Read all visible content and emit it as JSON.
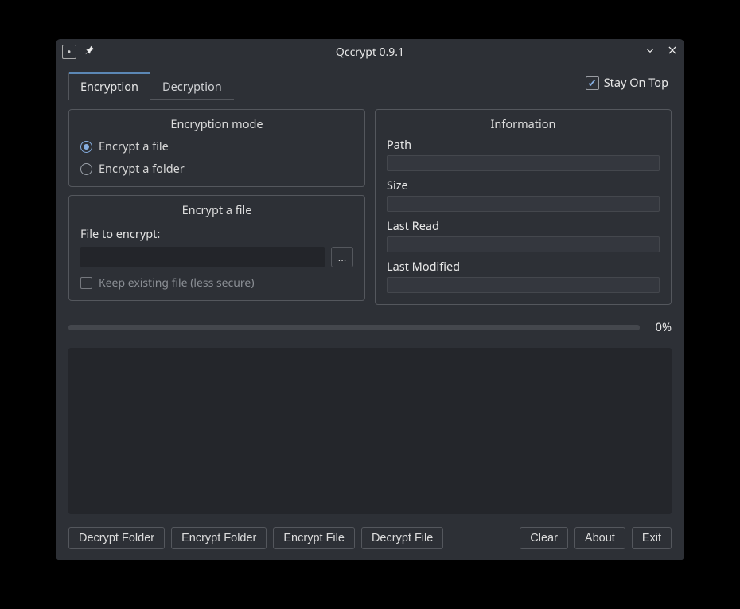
{
  "window": {
    "title": "Qccrypt 0.9.1"
  },
  "stay_on_top": {
    "label": "Stay On Top",
    "checked": true
  },
  "tabs": {
    "encryption": "Encryption",
    "decryption": "Decryption",
    "active": "encryption"
  },
  "mode_group": {
    "title": "Encryption mode",
    "encrypt_file": "Encrypt a file",
    "encrypt_folder": "Encrypt a folder",
    "selected": "encrypt_file"
  },
  "file_group": {
    "title": "Encrypt a file",
    "label": "File to encrypt:",
    "value": "",
    "browse": "...",
    "keep": "Keep existing file (less secure)",
    "keep_checked": false
  },
  "info_group": {
    "title": "Information",
    "path_label": "Path",
    "path_value": "",
    "size_label": "Size",
    "size_value": "",
    "last_read_label": "Last Read",
    "last_read_value": "",
    "last_modified_label": "Last Modified",
    "last_modified_value": ""
  },
  "progress": {
    "pct": "0%"
  },
  "buttons": {
    "decrypt_folder": "Decrypt Folder",
    "encrypt_folder": "Encrypt Folder",
    "encrypt_file": "Encrypt File",
    "decrypt_file": "Decrypt File",
    "clear": "Clear",
    "about": "About",
    "exit": "Exit"
  }
}
